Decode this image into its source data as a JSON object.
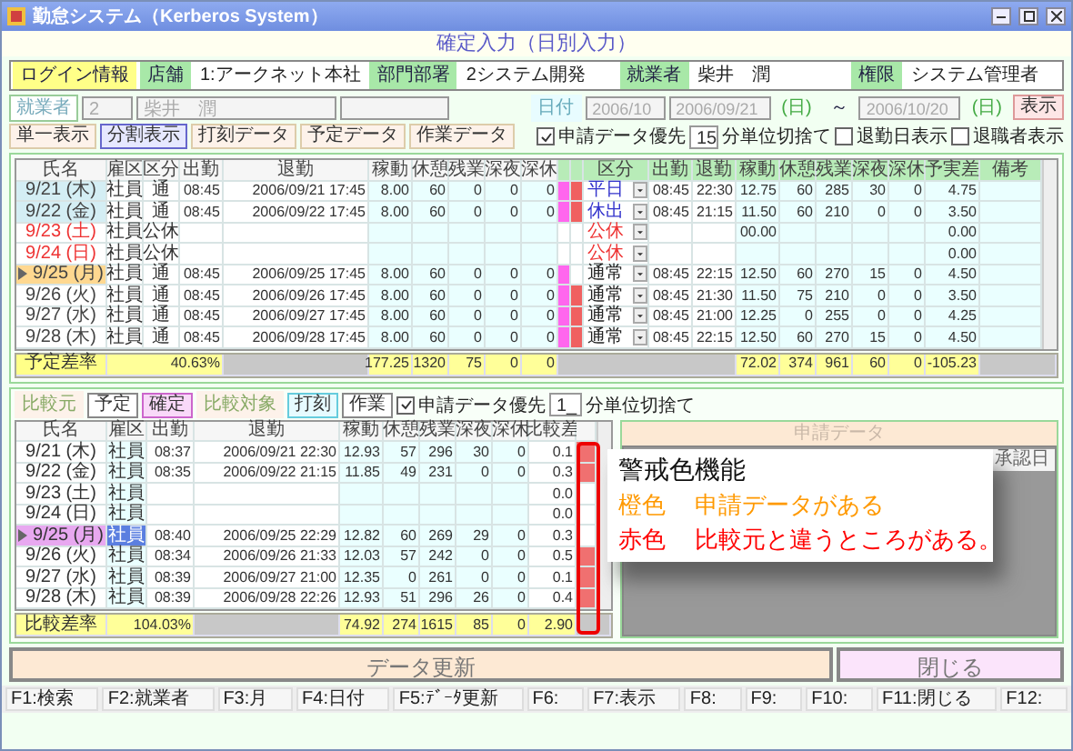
{
  "window": {
    "title": "勤怠システム（Kerberos System）"
  },
  "page_title": "確定入力（日別入力）",
  "login_info": {
    "label": "ログイン情報",
    "fields": [
      {
        "label": "店舗",
        "value": "1:アークネット本社"
      },
      {
        "label": "部門部署",
        "value": "2システム開発"
      },
      {
        "label": "就業者",
        "value": "柴井　潤"
      },
      {
        "label": "権限",
        "value": "システム管理者"
      }
    ]
  },
  "filter": {
    "employee_label": "就業者",
    "employee_code": "2",
    "employee_name": "柴井　潤",
    "date_label": "日付",
    "month": "2006/10",
    "from": "2006/09/21",
    "from_day": "(日)",
    "tilde": "～",
    "to": "2006/10/20",
    "to_day": "(日)",
    "show_button": "表示"
  },
  "view_buttons": [
    {
      "label": "単一表示",
      "selected": false
    },
    {
      "label": "分割表示",
      "selected": true
    },
    {
      "label": "打刻データ",
      "selected": false
    },
    {
      "label": "予定データ",
      "selected": false
    },
    {
      "label": "作業データ",
      "selected": false
    }
  ],
  "options": {
    "priority": {
      "label": "申請データ優先",
      "checked": true
    },
    "unit": "15",
    "unit_label": "分単位切捨て",
    "show_out_date": {
      "label": "退勤日表示",
      "checked": false
    },
    "show_retired": {
      "label": "退職者表示",
      "checked": false
    }
  },
  "upper_table": {
    "columns": [
      "氏名",
      "雇区",
      "区分",
      "出勤",
      "退勤",
      "稼動",
      "休憩",
      "残業",
      "深夜",
      "深休"
    ],
    "actual_columns": [
      "区分",
      "出勤",
      "退勤",
      "稼動",
      "休憩",
      "残業",
      "深夜",
      "深休",
      "予実差",
      "備考"
    ],
    "rows": [
      {
        "date": "9/21 (木)",
        "holiday": false,
        "selected": false,
        "confirmed": true,
        "employment": "社員",
        "category": "通",
        "in": "08:45",
        "out": "2006/09/21 17:45",
        "work": "8.00",
        "break": "60",
        "overtime": "0",
        "night": "0",
        "night_break": "0",
        "application": true,
        "difference": true,
        "actual": {
          "category": {
            "text": "平日",
            "color": "#3333cc"
          },
          "in": "08:45",
          "out": "22:30",
          "work": "12.75",
          "break": "60",
          "overtime": "285",
          "night": "30",
          "night_break": "0",
          "diff": "4.75"
        }
      },
      {
        "date": "9/22 (金)",
        "holiday": false,
        "selected": false,
        "confirmed": true,
        "employment": "社員",
        "category": "通",
        "in": "08:45",
        "out": "2006/09/22 17:45",
        "work": "8.00",
        "break": "60",
        "overtime": "0",
        "night": "0",
        "night_break": "0",
        "application": true,
        "difference": true,
        "actual": {
          "category": {
            "text": "休出",
            "color": "#3333cc"
          },
          "in": "08:45",
          "out": "21:15",
          "work": "11.50",
          "break": "60",
          "overtime": "210",
          "night": "0",
          "night_break": "0",
          "diff": "3.50"
        }
      },
      {
        "date": "9/23 (土)",
        "holiday": true,
        "selected": false,
        "confirmed": false,
        "employment": "社員",
        "category": "公休",
        "application": false,
        "difference": false,
        "actual": {
          "category": {
            "text": "公休",
            "color": "#ee3333"
          },
          "work": "00.00",
          "diff": "0.00"
        }
      },
      {
        "date": "9/24 (日)",
        "holiday": true,
        "selected": false,
        "confirmed": false,
        "employment": "社員",
        "category": "公休",
        "application": false,
        "difference": false,
        "actual": {
          "category": {
            "text": "公休",
            "color": "#ee3333"
          },
          "diff": "0.00"
        }
      },
      {
        "date": "9/25 (月)",
        "holiday": false,
        "selected": true,
        "confirmed": false,
        "employment": "社員",
        "category": "通",
        "in": "08:45",
        "out": "2006/09/25 17:45",
        "work": "8.00",
        "break": "60",
        "overtime": "0",
        "night": "0",
        "night_break": "0",
        "application": true,
        "difference": false,
        "actual": {
          "category": {
            "text": "通常",
            "color": "#222222"
          },
          "in": "08:45",
          "out": "22:15",
          "work": "12.50",
          "break": "60",
          "overtime": "270",
          "night": "15",
          "night_break": "0",
          "diff": "4.50"
        }
      },
      {
        "date": "9/26 (火)",
        "holiday": false,
        "selected": false,
        "confirmed": false,
        "employment": "社員",
        "category": "通",
        "in": "08:45",
        "out": "2006/09/26 17:45",
        "work": "8.00",
        "break": "60",
        "overtime": "0",
        "night": "0",
        "night_break": "0",
        "application": true,
        "difference": true,
        "actual": {
          "category": {
            "text": "通常",
            "color": "#222222"
          },
          "in": "08:45",
          "out": "21:30",
          "work": "11.50",
          "break": "75",
          "overtime": "210",
          "night": "0",
          "night_break": "0",
          "diff": "3.50"
        }
      },
      {
        "date": "9/27 (水)",
        "holiday": false,
        "selected": false,
        "confirmed": false,
        "employment": "社員",
        "category": "通",
        "in": "08:45",
        "out": "2006/09/27 17:45",
        "work": "8.00",
        "break": "60",
        "overtime": "0",
        "night": "0",
        "night_break": "0",
        "application": true,
        "difference": true,
        "actual": {
          "category": {
            "text": "通常",
            "color": "#222222"
          },
          "in": "08:45",
          "out": "21:00",
          "work": "12.25",
          "break": "0",
          "overtime": "255",
          "night": "0",
          "night_break": "0",
          "diff": "4.25"
        }
      },
      {
        "date": "9/28 (木)",
        "holiday": false,
        "selected": false,
        "confirmed": false,
        "employment": "社員",
        "category": "通",
        "in": "08:45",
        "out": "2006/09/28 17:45",
        "work": "8.00",
        "break": "60",
        "overtime": "0",
        "night": "0",
        "night_break": "0",
        "application": true,
        "difference": true,
        "actual": {
          "category": {
            "text": "通常",
            "color": "#222222"
          },
          "in": "08:45",
          "out": "22:15",
          "work": "12.50",
          "break": "60",
          "overtime": "270",
          "night": "15",
          "night_break": "0",
          "diff": "4.50"
        }
      }
    ],
    "summary": {
      "label": "予定差率",
      "rate": "40.63%",
      "work": "177.25",
      "break": "1320",
      "overtime": "75",
      "night": "0",
      "night_break": "0",
      "actual_work": "72.02",
      "actual_break": "374",
      "actual_overtime": "961",
      "actual_night": "60",
      "actual_night_break": "0",
      "diff": "-105.23"
    }
  },
  "compare_bar": {
    "source_label": "比較元",
    "source_buttons": [
      {
        "label": "予定",
        "selected": false
      },
      {
        "label": "確定",
        "selected": true
      }
    ],
    "target_label": "比較対象",
    "target_buttons": [
      {
        "label": "打刻",
        "selected": true
      },
      {
        "label": "作業",
        "selected": false
      }
    ],
    "priority": {
      "label": "申請データ優先",
      "checked": true
    },
    "unit": "1_",
    "unit_label": "分単位切捨て"
  },
  "lower_table": {
    "columns": [
      "氏名",
      "雇区",
      "出勤",
      "退勤",
      "稼動",
      "休憩",
      "残業",
      "深夜",
      "深休",
      "比較差"
    ],
    "rows": [
      {
        "date": "9/21 (木)",
        "selected": false,
        "employment": "社員",
        "in": "08:37",
        "out": "2006/09/21 22:30",
        "work": "12.93",
        "break": "57",
        "overtime": "296",
        "night": "30",
        "night_break": "0",
        "diff": "0.1",
        "difference": true
      },
      {
        "date": "9/22 (金)",
        "selected": false,
        "employment": "社員",
        "in": "08:35",
        "out": "2006/09/22 21:15",
        "work": "11.85",
        "break": "49",
        "overtime": "231",
        "night": "0",
        "night_break": "0",
        "diff": "0.3",
        "difference": true
      },
      {
        "date": "9/23 (土)",
        "selected": false,
        "employment": "社員",
        "diff": "0.0",
        "difference": false
      },
      {
        "date": "9/24 (日)",
        "selected": false,
        "employment": "社員",
        "diff": "0.0",
        "difference": false
      },
      {
        "date": "9/25 (月)",
        "selected": true,
        "employment": "社員",
        "in": "08:40",
        "out": "2006/09/25 22:29",
        "work": "12.82",
        "break": "60",
        "overtime": "269",
        "night": "29",
        "night_break": "0",
        "diff": "0.3",
        "difference": false
      },
      {
        "date": "9/26 (火)",
        "selected": false,
        "employment": "社員",
        "in": "08:34",
        "out": "2006/09/26 21:33",
        "work": "12.03",
        "break": "57",
        "overtime": "242",
        "night": "0",
        "night_break": "0",
        "diff": "0.5",
        "difference": true
      },
      {
        "date": "9/27 (水)",
        "selected": false,
        "employment": "社員",
        "in": "08:39",
        "out": "2006/09/27 21:00",
        "work": "12.35",
        "break": "0",
        "overtime": "261",
        "night": "0",
        "night_break": "0",
        "diff": "0.1",
        "difference": true
      },
      {
        "date": "9/28 (木)",
        "selected": false,
        "employment": "社員",
        "in": "08:39",
        "out": "2006/09/28 22:26",
        "work": "12.93",
        "break": "51",
        "overtime": "296",
        "night": "26",
        "night_break": "0",
        "diff": "0.4",
        "difference": true
      }
    ],
    "summary": {
      "label": "比較差率",
      "rate": "104.03%",
      "work": "74.92",
      "break": "274",
      "overtime": "1615",
      "night": "85",
      "night_break": "0",
      "diff": "2.90"
    }
  },
  "application_panel": {
    "title": "申請データ",
    "last_column": "承認日"
  },
  "callout": {
    "title": "警戒色機能",
    "lines": [
      {
        "label": "橙色",
        "text": "申請データがある",
        "color": "#ff9900"
      },
      {
        "label": "赤色",
        "text": "比較元と違うところがある。",
        "color": "#ff0000"
      }
    ]
  },
  "actions": [
    {
      "label": "データ更新",
      "kind": "primary"
    },
    {
      "label": "閉じる",
      "kind": "close"
    }
  ],
  "function_keys": [
    "F1:検索",
    "F2:就業者",
    "F3:月",
    "F4:日付",
    "F5:ﾃﾞｰﾀ更新",
    "F6:",
    "F7:表示",
    "F8:",
    "F9:",
    "F10:",
    "F11:閉じる",
    "F12:"
  ]
}
